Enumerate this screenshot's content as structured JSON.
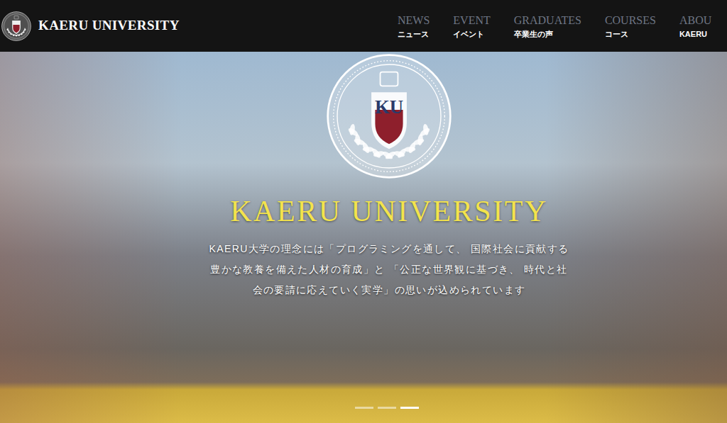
{
  "header": {
    "logo_text": "KAERU UNIVERSITY",
    "nav": [
      {
        "label": "NEWS",
        "sublabel": "ニュース"
      },
      {
        "label": "EVENT",
        "sublabel": "イベント"
      },
      {
        "label": "GRADUATES",
        "sublabel": "卒業生の声"
      },
      {
        "label": "COURSES",
        "sublabel": "コース"
      },
      {
        "label": "ABOU",
        "sublabel": "KAERU"
      }
    ]
  },
  "hero": {
    "emblem_letters": "KU",
    "title": "KAERU UNIVERSITY",
    "description": "KAERU大学の理念には「プログラミングを通して、 国際社会に貢献する豊かな教養を備えた人材の育成」と 「公正な世界観に基づき、 時代と社会の要請に応えていく実学」の思いが込められています",
    "slides": [
      {
        "selected": false
      },
      {
        "selected": false
      },
      {
        "selected": true
      }
    ]
  }
}
